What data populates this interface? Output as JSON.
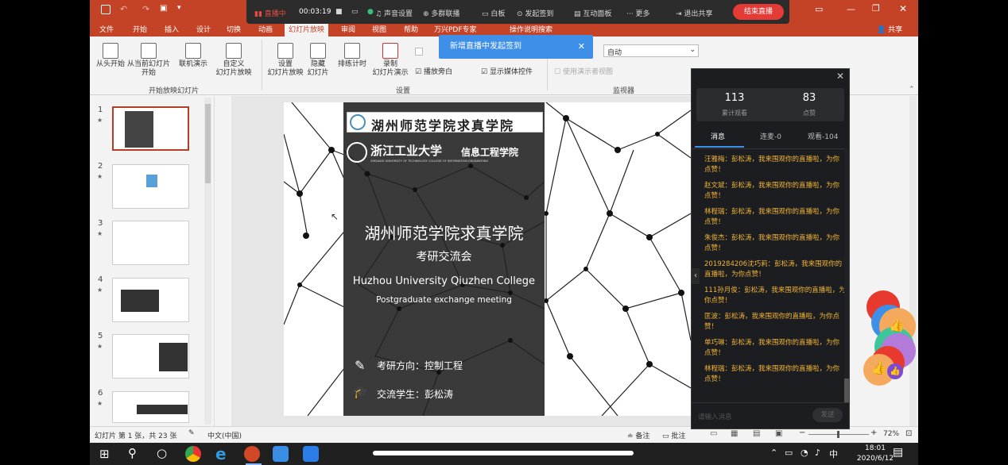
{
  "titlebar": {
    "right_share": "共享"
  },
  "ribbon_tabs": [
    "文件",
    "开始",
    "插入",
    "设计",
    "切换",
    "动画",
    "幻灯片放映",
    "审阅",
    "视图",
    "帮助",
    "万兴PDF专家",
    "操作说明搜索"
  ],
  "ribbon": {
    "btn_from_start": "从头开始",
    "btn_from_current": "从当前幻灯片\n开始",
    "btn_online": "联机演示",
    "btn_custom": "自定义\n幻灯片放映",
    "group_start": "开始放映幻灯片",
    "btn_setup": "设置\n幻灯片放映",
    "btn_hide": "隐藏\n幻灯片",
    "btn_rehearse": "排练计时",
    "btn_record": "录制\n幻灯片演示",
    "cb_narration": "播放旁白",
    "cb_media": "显示媒体控件",
    "group_setup": "设置",
    "cb_use_presenter": "使用演示者视图",
    "monitor_value": "自动",
    "group_monitor": "监视器"
  },
  "live_bar": {
    "status": "直播中",
    "time": "00:03:19",
    "mic": "",
    "sound": "声音设置",
    "multi_cam": "多群联播",
    "whiteboard": "白板",
    "sign_in": "发起签到",
    "interact": "互动面板",
    "more": "更多",
    "exit_share": "退出共享",
    "end_live": "结束直播"
  },
  "toast": {
    "text": "新增直播中发起签到"
  },
  "thumbnails": [
    {
      "num": "1"
    },
    {
      "num": "2"
    },
    {
      "num": "3"
    },
    {
      "num": "4"
    },
    {
      "num": "5"
    },
    {
      "num": "6"
    }
  ],
  "slide": {
    "top_logo_text": "湖州师范学院求真学院",
    "zjut_name": "浙江工业大学",
    "zjut_dept": "信息工程学院",
    "zjut_en": "ZHEJIANG UNIVERSITY OF TECHNOLOGY   COLLEGE OF INFORMATION ENGINEERING",
    "title_cn": "湖州师范学院求真学院",
    "subtitle_cn": "考研交流会",
    "title_en": "Huzhou University Qiuzhen College",
    "subtitle_en": "Postgraduate exchange meeting",
    "line1": "考研方向：控制工程",
    "line2": "交流学生：彭松涛"
  },
  "chat": {
    "total_views": "113",
    "total_views_label": "累计观看",
    "likes": "83",
    "likes_label": "点赞",
    "tab_msg": "消息",
    "tab_connect": "连麦-0",
    "tab_watch": "观看-104",
    "messages": [
      "汪雅梅：彭松涛，我来围观你的直播啦，为你点赞！",
      "赵文斌：彭松涛，我来围观你的直播啦，为你点赞！",
      "林程瑞：彭松涛，我来围观你的直播啦，为你点赞！",
      "朱俊杰：彭松涛，我来围观你的直播啦，为你点赞！",
      "2019284206沈巧莉：彭松涛，我来围观你的直播啦，为你点赞！",
      "111孙月俊：彭松涛，我来围观你的直播啦，为你点赞！",
      "匡波：彭松涛，我来围观你的直播啦，为你点赞！",
      "单巧琳：彭松涛，我来围观你的直播啦，为你点赞！",
      "林程瑞：彭松涛，我来围观你的直播啦，为你点赞！"
    ],
    "input_placeholder": "请输入消息",
    "send": "发送"
  },
  "statusbar": {
    "slide_info": "幻灯片 第 1 张，共 23 张",
    "lang": "中文(中国)",
    "notes": "备注",
    "comments": "批注",
    "zoom": "72%"
  },
  "taskbar": {
    "time": "18:01",
    "date": "2020/6/12",
    "ime": "中"
  }
}
